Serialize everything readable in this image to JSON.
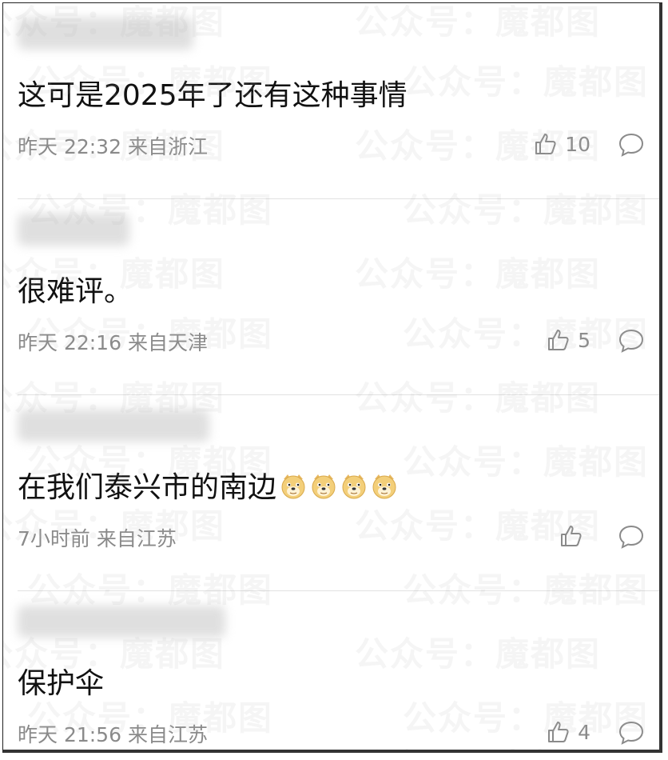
{
  "watermark": "公众号：魔都图",
  "comments": [
    {
      "username_hidden": true,
      "text": "这可是2025年了还有这种事情",
      "meta": "昨天 22:32 来自浙江",
      "likes": "10",
      "emoji_count": 0
    },
    {
      "username_hidden": true,
      "text": "很难评。",
      "meta": "昨天 22:16 来自天津",
      "likes": "5",
      "emoji_count": 0
    },
    {
      "username_hidden": true,
      "text": "在我们泰兴市的南边",
      "meta": "7小时前 来自江苏",
      "likes": "",
      "emoji_count": 4
    },
    {
      "username_hidden": true,
      "text": "保护伞",
      "meta": "昨天 21:56 来自江苏",
      "likes": "4",
      "emoji_count": 0
    }
  ],
  "icons": {
    "like": "thumbs-up-icon",
    "reply": "comment-bubble-icon",
    "emoji": "doge-emoji-icon"
  },
  "colors": {
    "meta": "#8a8a8a",
    "text": "#111111",
    "divider": "#e2e2e2"
  }
}
